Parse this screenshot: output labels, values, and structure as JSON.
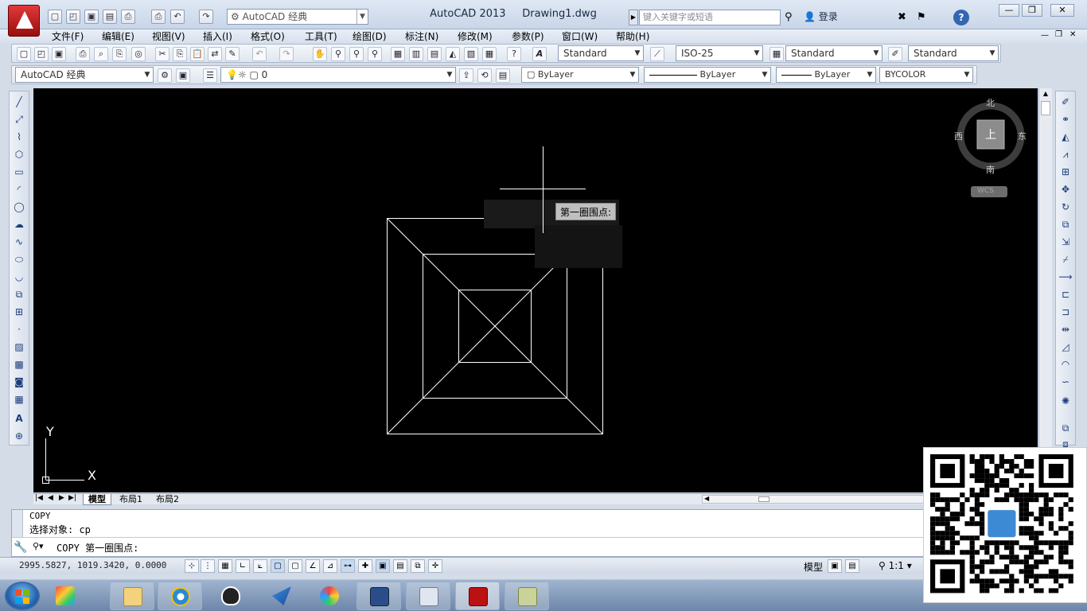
{
  "window": {
    "app_title": "AutoCAD 2013",
    "file_name": "Drawing1.dwg",
    "workspace": "AutoCAD 经典",
    "search_placeholder": "键入关键字或短语",
    "login_label": "登录",
    "minimize": "—",
    "restore": "❐",
    "close": "✕"
  },
  "menu": {
    "items": [
      "文件(F)",
      "编辑(E)",
      "视图(V)",
      "插入(I)",
      "格式(O)",
      "工具(T)",
      "绘图(D)",
      "标注(N)",
      "修改(M)",
      "参数(P)",
      "窗口(W)",
      "帮助(H)"
    ]
  },
  "styles_toolbar": {
    "text_style": "Standard",
    "dim_style": "ISO-25",
    "table_style": "Standard",
    "multileader_style": "Standard"
  },
  "layers_toolbar": {
    "workspace": "AutoCAD 经典",
    "current_layer": "0",
    "color": "ByLayer",
    "linetype": "ByLayer",
    "lineweight": "ByLayer",
    "plot_style": "BYCOLOR"
  },
  "viewcube": {
    "north": "北",
    "south": "南",
    "east": "东",
    "west": "西",
    "face": "上",
    "wcs": "WCS"
  },
  "cursor_tooltip": "第一圈围点:",
  "ucs_icon": {
    "x_label": "X",
    "y_label": "Y"
  },
  "layout_tabs": [
    "模型",
    "布局1",
    "布局2"
  ],
  "command": {
    "history_1": "COPY",
    "history_2": "选择对象: cp",
    "current_prompt": "COPY 第一圈围点:"
  },
  "statusbar": {
    "coordinates": "2995.5827, 1019.3420, 0.0000",
    "model_label": "模型",
    "scale_label": "1:1"
  },
  "colors": {
    "drawing_bg": "#000000",
    "drawing_lines": "#ffffff",
    "chrome": "#d4dce8"
  }
}
